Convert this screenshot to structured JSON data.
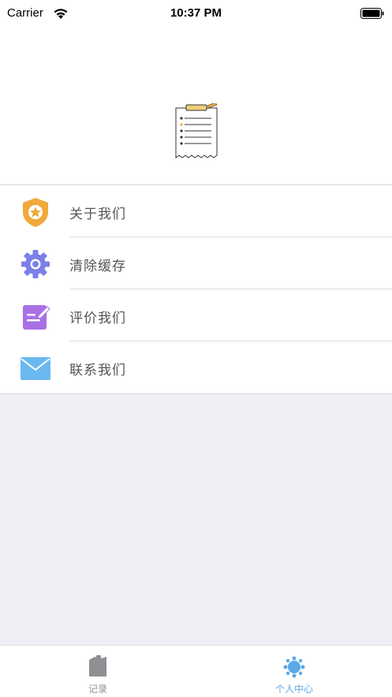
{
  "status_bar": {
    "carrier": "Carrier",
    "time": "10:37 PM",
    "icons": [
      "wifi-icon",
      "battery-icon"
    ]
  },
  "header": {
    "icon": "notepad-icon"
  },
  "menu": {
    "items": [
      {
        "label": "关于我们",
        "icon": "shield-star-icon",
        "color": "#f0a93a"
      },
      {
        "label": "清除缓存",
        "icon": "gear-icon",
        "color": "#7b7fe8"
      },
      {
        "label": "评价我们",
        "icon": "edit-note-icon",
        "color": "#a970e6"
      },
      {
        "label": "联系我们",
        "icon": "mail-icon",
        "color": "#6bb8f0"
      }
    ]
  },
  "tab_bar": {
    "tabs": [
      {
        "label": "记录",
        "icon": "records-icon",
        "active": false
      },
      {
        "label": "个人中心",
        "icon": "profile-center-icon",
        "active": true
      }
    ],
    "active_color": "#5aa9ea",
    "inactive_color": "#8e8e93"
  }
}
